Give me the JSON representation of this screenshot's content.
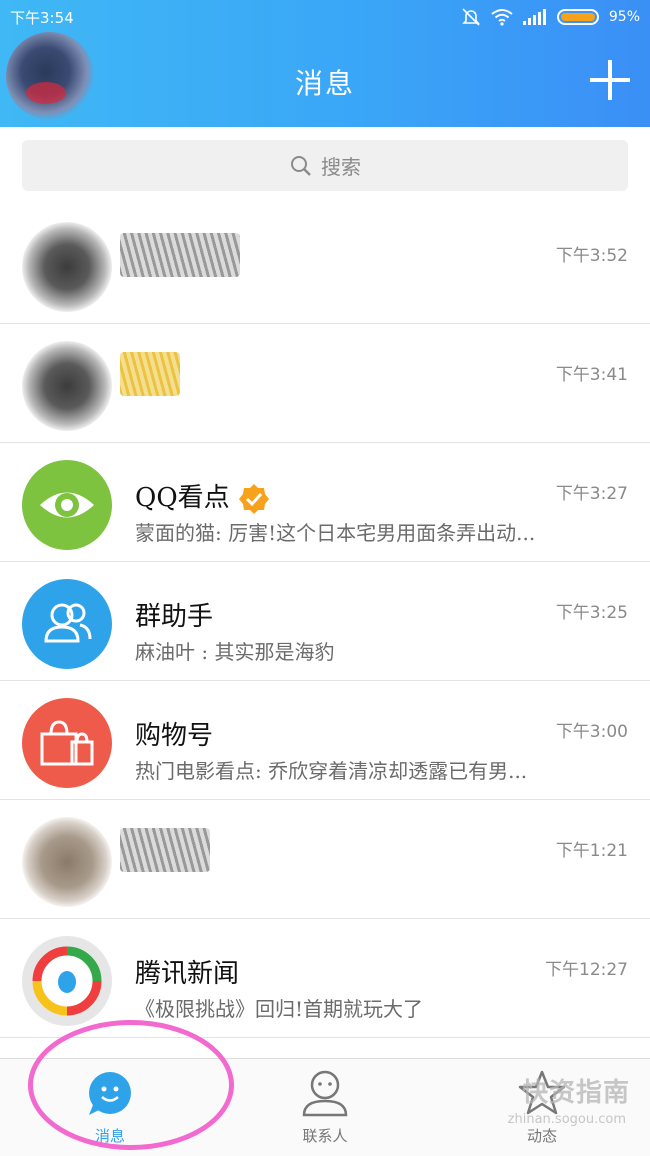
{
  "status_bar": {
    "time": "下午3:54",
    "battery": "95%"
  },
  "header": {
    "title": "消息"
  },
  "search": {
    "placeholder": "搜索"
  },
  "chats": [
    {
      "name": "",
      "preview": "",
      "time": "下午3:52"
    },
    {
      "name": "",
      "preview": "",
      "time": "下午3:41"
    },
    {
      "name": "QQ看点",
      "preview": "蒙面的猫: 厉害!这个日本宅男用面条弄出动...",
      "time": "下午3:27"
    },
    {
      "name": "群助手",
      "preview": "麻油叶 : 其实那是海豹",
      "time": "下午3:25"
    },
    {
      "name": "购物号",
      "preview": "热门电影看点: 乔欣穿着清凉却透露已有男...",
      "time": "下午3:00"
    },
    {
      "name": "",
      "preview": "",
      "time": "下午1:21"
    },
    {
      "name": "腾讯新闻",
      "preview": "《极限挑战》回归!首期就玩大了",
      "time": "下午12:27"
    }
  ],
  "tabs": [
    {
      "label": "消息"
    },
    {
      "label": "联系人"
    },
    {
      "label": "动态"
    }
  ],
  "watermark": {
    "text": "快资指南",
    "sub": "zhinan.sogou.com"
  },
  "colors": {
    "header_blue": "#3aa6f7",
    "qq_kandian_green": "#7dc340",
    "group_blue": "#2ea3ea",
    "shopping_red": "#ef5b4a",
    "verified_orange": "#f6a21a"
  }
}
